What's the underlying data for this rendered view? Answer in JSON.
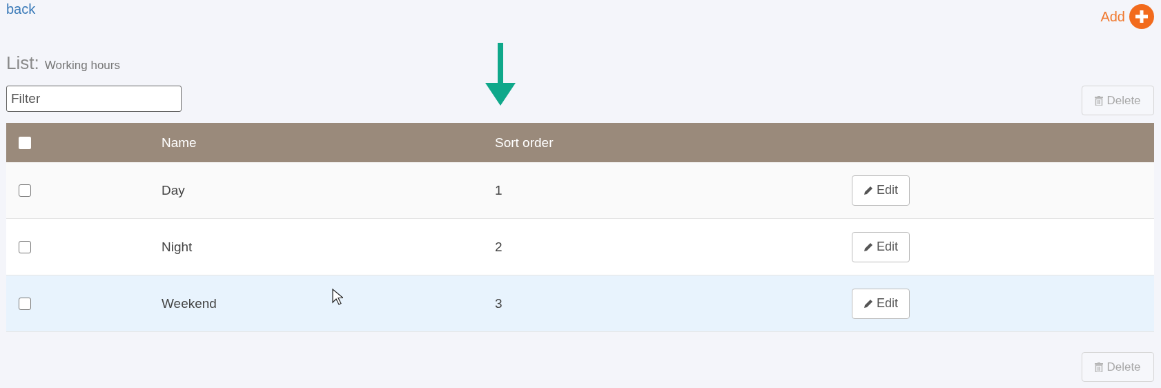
{
  "back_link": "back",
  "add_button": {
    "label": "Add"
  },
  "title": {
    "prefix": "List:",
    "name": "Working hours"
  },
  "filter": {
    "placeholder": "Filter"
  },
  "delete_buttons": [
    {
      "label": "Delete",
      "disabled": true
    },
    {
      "label": "Delete",
      "disabled": true
    }
  ],
  "table": {
    "select_all": {
      "checked": false
    },
    "columns": [
      "Name",
      "Sort order"
    ],
    "rows": [
      {
        "checked": false,
        "hovered": false,
        "cells": [
          "Day",
          "1"
        ],
        "action": "Edit"
      },
      {
        "checked": false,
        "hovered": false,
        "cells": [
          "Night",
          "2"
        ],
        "action": "Edit"
      },
      {
        "checked": false,
        "hovered": true,
        "cells": [
          "Weekend",
          "3"
        ],
        "action": "Edit"
      }
    ]
  }
}
